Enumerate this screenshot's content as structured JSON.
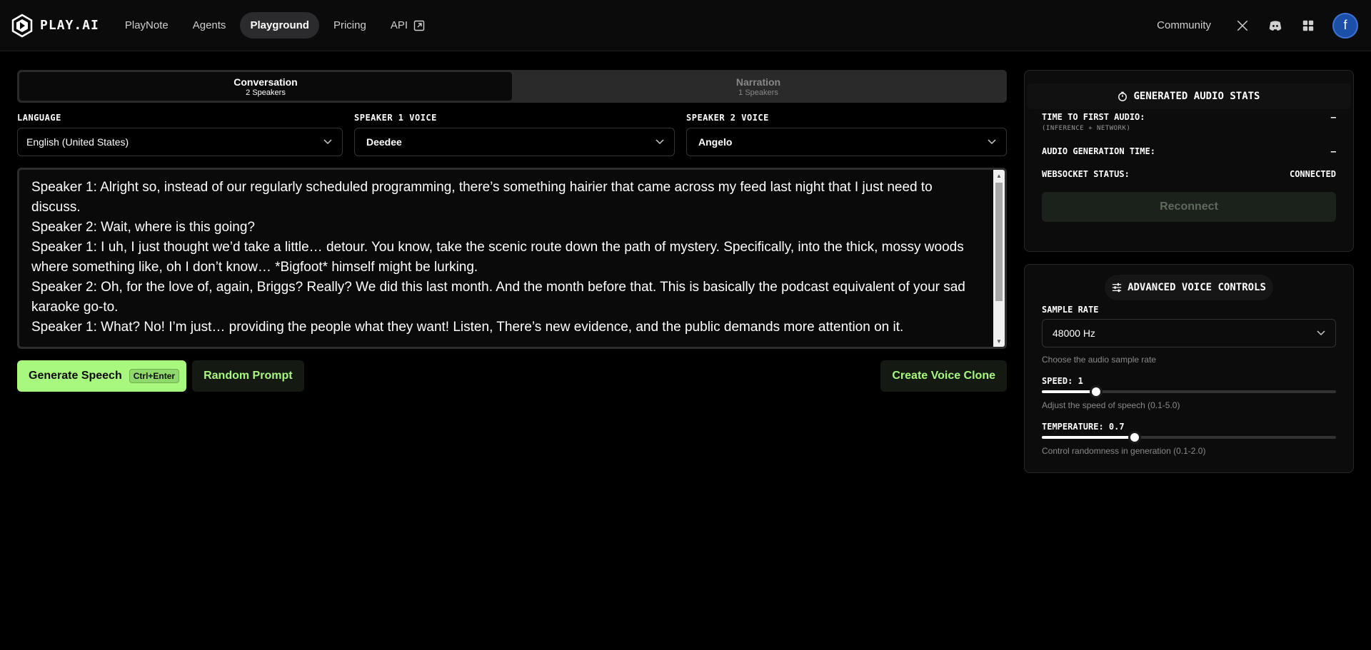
{
  "header": {
    "logo_text": "PLAY.AI",
    "nav": [
      {
        "label": "PlayNote"
      },
      {
        "label": "Agents"
      },
      {
        "label": "Playground"
      },
      {
        "label": "Pricing"
      },
      {
        "label": "API"
      }
    ],
    "community_label": "Community",
    "avatar_letter": "f"
  },
  "mode_tabs": [
    {
      "title": "Conversation",
      "sub": "2 Speakers"
    },
    {
      "title": "Narration",
      "sub": "1 Speakers"
    }
  ],
  "selects": {
    "language": {
      "label": "LANGUAGE",
      "value": "English (United States)"
    },
    "speaker1": {
      "label": "SPEAKER 1 VOICE",
      "value": "Deedee"
    },
    "speaker2": {
      "label": "SPEAKER 2 VOICE",
      "value": "Angelo"
    }
  },
  "prompt_text": "Speaker 1: Alright so, instead of our regularly scheduled programming, there’s something hairier that came across my feed last night that I just need to discuss.\nSpeaker 2: Wait, where is this going?\nSpeaker 1: I uh, I just thought we’d take a little… detour. You know, take the scenic route down the path of mystery. Specifically, into the thick, mossy woods where something like, oh I don’t know… *Bigfoot* himself might be lurking.\nSpeaker 2: Oh, for the love of, again, Briggs? Really? We did this last month. And the month before that. This is basically the podcast equivalent of your sad karaoke go-to.\nSpeaker 1: What? No! I’m just… providing the people what they want! Listen, There’s new evidence, and the public demands more attention on it.",
  "actions": {
    "generate_label": "Generate Speech",
    "generate_shortcut": "Ctrl+Enter",
    "random_label": "Random Prompt",
    "clone_label": "Create Voice Clone"
  },
  "stats": {
    "title": "GENERATED AUDIO STATS",
    "ttfa_label": "TIME TO FIRST AUDIO:",
    "ttfa_sub": "(INFERENCE + NETWORK)",
    "ttfa_value": "—",
    "gen_time_label": "AUDIO GENERATION TIME:",
    "gen_time_value": "—",
    "ws_label": "WEBSOCKET STATUS:",
    "ws_value": "CONNECTED",
    "reconnect_label": "Reconnect"
  },
  "controls": {
    "title": "ADVANCED VOICE CONTROLS",
    "sample_rate_label": "SAMPLE RATE",
    "sample_rate_value": "48000 Hz",
    "sample_rate_help": "Choose the audio sample rate",
    "speed_label": "SPEED: 1",
    "speed_value": 1,
    "speed_min": 0.1,
    "speed_max": 5.0,
    "speed_help": "Adjust the speed of speech (0.1-5.0)",
    "temp_label": "TEMPERATURE: 0.7",
    "temp_value": 0.7,
    "temp_min": 0.1,
    "temp_max": 2.0,
    "temp_help": "Control randomness in generation (0.1-2.0)"
  },
  "colors": {
    "accent": "#a8f77f",
    "background": "#000000"
  }
}
